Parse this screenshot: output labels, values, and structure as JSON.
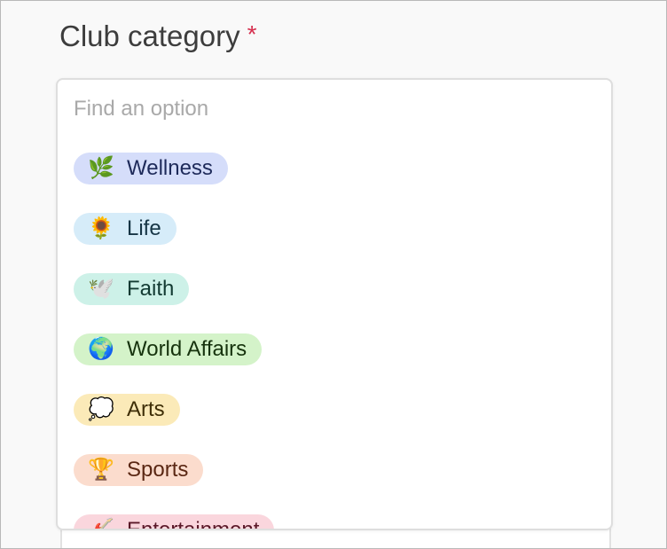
{
  "field": {
    "label": "Club category",
    "required_mark": "*"
  },
  "search": {
    "placeholder": "Find an option",
    "value": ""
  },
  "options": [
    {
      "emoji": "🌿",
      "icon": "herb-icon",
      "label": "Wellness",
      "bg": "#d5ddfa",
      "fg": "#1e2a5a"
    },
    {
      "emoji": "🌻",
      "icon": "sunflower-icon",
      "label": "Life",
      "bg": "#d6ecf9",
      "fg": "#163545"
    },
    {
      "emoji": "🕊️",
      "icon": "dove-icon",
      "label": "Faith",
      "bg": "#cdf1e8",
      "fg": "#123a32"
    },
    {
      "emoji": "🌍",
      "icon": "globe-icon",
      "label": "World Affairs",
      "bg": "#d4f3c9",
      "fg": "#16330d"
    },
    {
      "emoji": "💭",
      "icon": "thought-bubble-icon",
      "label": "Arts",
      "bg": "#fbeab8",
      "fg": "#3e2e06"
    },
    {
      "emoji": "🏆",
      "icon": "trophy-icon",
      "label": "Sports",
      "bg": "#fbdccd",
      "fg": "#5a2713"
    },
    {
      "emoji": "🎸",
      "icon": "guitar-icon",
      "label": "Entertainment",
      "bg": "#fad6dd",
      "fg": "#5a1828"
    }
  ],
  "colors": {
    "required": "#d6304f",
    "label_text": "#3d3d3d",
    "placeholder": "#a9a9a9"
  }
}
